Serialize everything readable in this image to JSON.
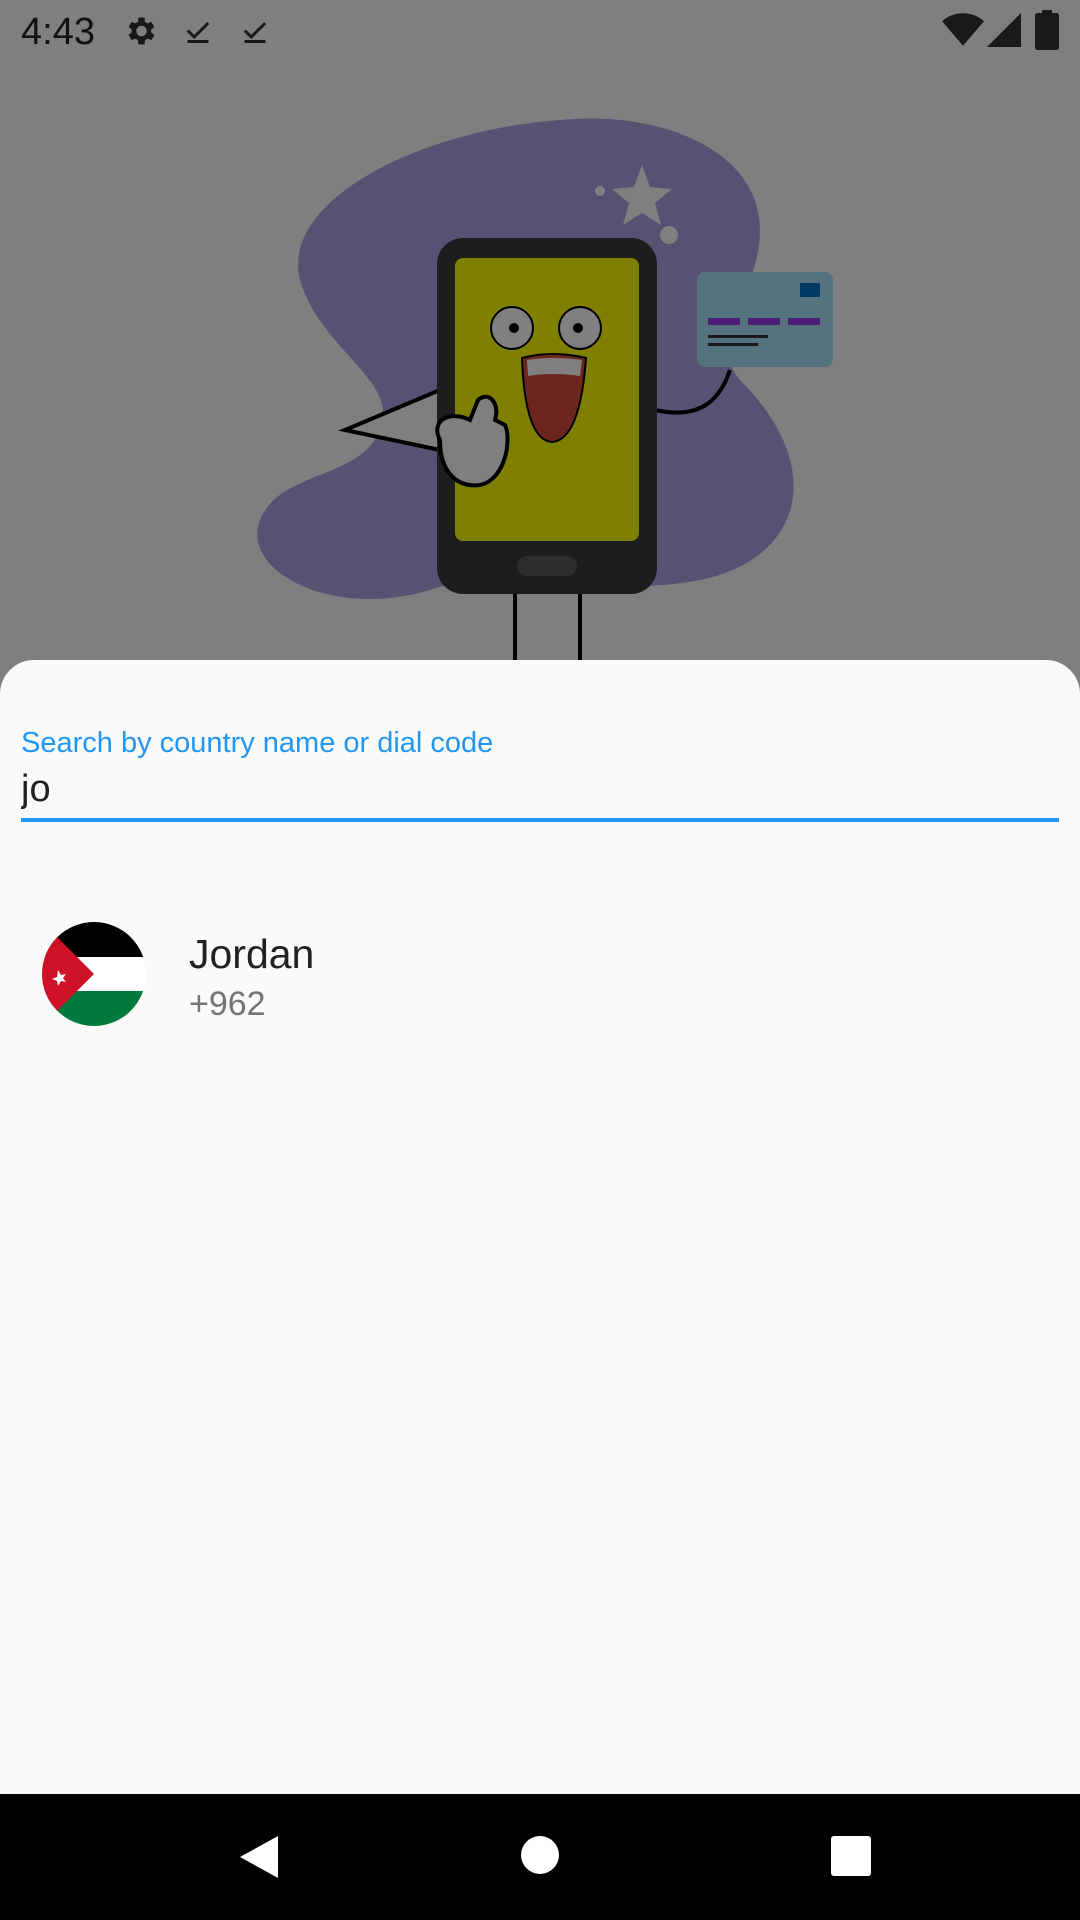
{
  "status_bar": {
    "time": "4:43",
    "icons": [
      "settings-icon",
      "download-done-icon",
      "download-done-icon",
      "wifi-icon",
      "cell-signal-icon",
      "battery-icon"
    ]
  },
  "search": {
    "label": "Search by country name or dial code",
    "value": "jo",
    "accent_color": "#2196f3"
  },
  "results": [
    {
      "name": "Jordan",
      "dial_code": "+962",
      "flag": "jordan-flag-icon"
    }
  ],
  "nav_bar": {
    "buttons": [
      "back-icon",
      "home-icon",
      "recents-icon"
    ]
  }
}
